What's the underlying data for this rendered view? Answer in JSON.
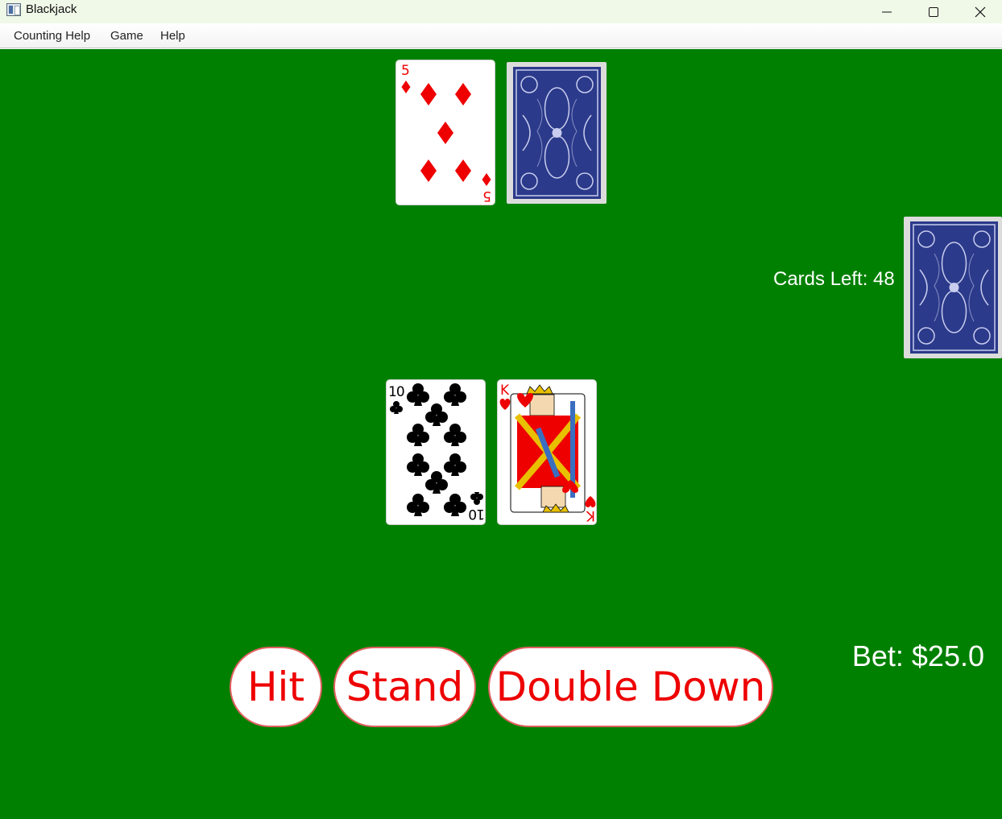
{
  "window": {
    "title": "Blackjack"
  },
  "menu": {
    "counting_help": "Counting Help",
    "game": "Game",
    "help": "Help"
  },
  "dealer": {
    "cards": [
      {
        "rank": "5",
        "suit": "diamonds",
        "face_up": true
      },
      {
        "face_up": false
      }
    ]
  },
  "player": {
    "cards": [
      {
        "rank": "10",
        "suit": "clubs",
        "face_up": true
      },
      {
        "rank": "K",
        "suit": "hearts",
        "face_up": true
      }
    ]
  },
  "shoe": {
    "cards_left_label": "Cards Left: 48"
  },
  "bet": {
    "label": "Bet: $25.0"
  },
  "actions": {
    "hit": "Hit",
    "stand": "Stand",
    "double_down": "Double Down"
  },
  "colors": {
    "felt": "#008000",
    "red_suit": "#ee0000",
    "black_suit": "#000000",
    "card_back": "#2b3a8a",
    "button_text": "#ee0000"
  }
}
